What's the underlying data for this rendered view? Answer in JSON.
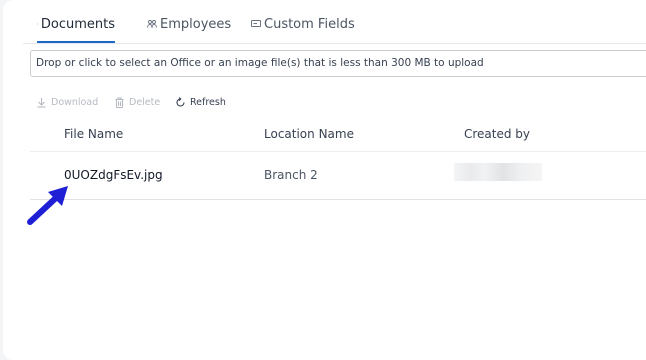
{
  "tabs": [
    {
      "label": "Documents",
      "icon": "document-icon",
      "active": true
    },
    {
      "label": "Employees",
      "icon": "people-icon",
      "active": false
    },
    {
      "label": "Custom Fields",
      "icon": "field-icon",
      "active": false
    }
  ],
  "upload": {
    "text": "Drop or click to select an Office or an image file(s) that is less than 300 MB to upload"
  },
  "toolbar": {
    "download_label": "Download",
    "delete_label": "Delete",
    "refresh_label": "Refresh"
  },
  "table": {
    "headers": [
      "File Name",
      "Location Name",
      "Created by"
    ],
    "rows": [
      {
        "file_name": "0UOZdgFsEv.jpg",
        "location": "Branch 2",
        "created_by": ""
      }
    ]
  },
  "colors": {
    "accent": "#1e67c8",
    "annotation_arrow": "#1f1fd6"
  }
}
